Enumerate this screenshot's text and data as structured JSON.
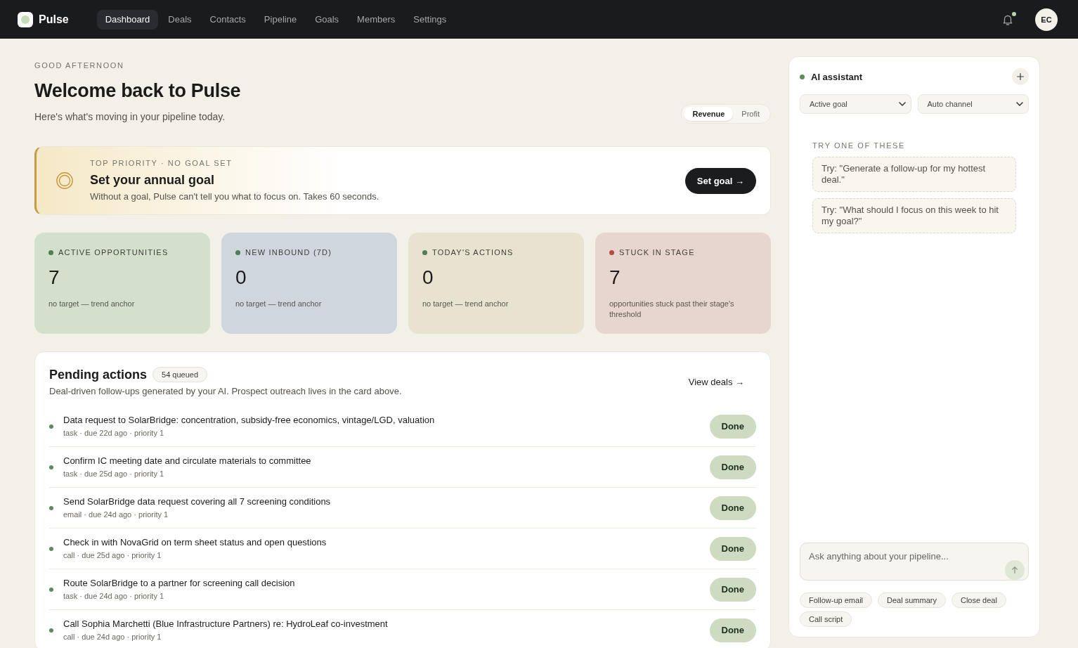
{
  "nav": {
    "logo": "Pulse",
    "links": [
      {
        "label": "Dashboard",
        "selected": true
      },
      {
        "label": "Deals",
        "selected": false
      },
      {
        "label": "Contacts",
        "selected": false
      },
      {
        "label": "Pipeline",
        "selected": false
      },
      {
        "label": "Goals",
        "selected": false
      },
      {
        "label": "Members",
        "selected": false
      },
      {
        "label": "Settings",
        "selected": false
      }
    ],
    "notifications": {
      "unread": true
    },
    "avatar": "EC"
  },
  "header": {
    "eyebrow": "GOOD AFTERNOON",
    "title": "Welcome back to Pulse",
    "subtitle": "Here's what's moving in your pipeline today.",
    "toggle": [
      {
        "label": "Revenue",
        "selected": true
      },
      {
        "label": "Profit",
        "selected": false
      }
    ]
  },
  "priority": {
    "eyebrow": "TOP PRIORITY · NO GOAL SET",
    "title": "Set your annual goal",
    "description": "Without a goal, Pulse can't tell you what to focus on. Takes 60 seconds.",
    "button": "Set goal →"
  },
  "stats": [
    {
      "kind": "opportunities",
      "label": "ACTIVE OPPORTUNITIES",
      "value": "7",
      "note": "no target — trend anchor",
      "color": "#4f7f55"
    },
    {
      "kind": "inbound",
      "label": "NEW INBOUND (7D)",
      "value": "0",
      "note": "no target — trend anchor",
      "color": "#4f7f55"
    },
    {
      "kind": "actions",
      "label": "TODAY'S ACTIONS",
      "value": "0",
      "note": "no target — trend anchor",
      "color": "#4f7f55"
    },
    {
      "kind": "stuck",
      "label": "STUCK IN STAGE",
      "value": "7",
      "note": "opportunities stuck past their stage's threshold",
      "color": "#b44b3d"
    }
  ],
  "pending": {
    "title": "Pending actions",
    "badge": "54 queued",
    "subtitle": "Deal-driven follow-ups generated by your AI. Prospect outreach lives in the card above.",
    "link": "View deals →",
    "items": [
      {
        "title": "Data request to SolarBridge: concentration, subsidy-free economics, vintage/LGD, valuation",
        "meta": "task · due 22d ago · priority 1",
        "button": "Done"
      },
      {
        "title": "Confirm IC meeting date and circulate materials to committee",
        "meta": "task · due 25d ago · priority 1",
        "button": "Done"
      },
      {
        "title": "Send SolarBridge data request covering all 7 screening conditions",
        "meta": "email · due 24d ago · priority 1",
        "button": "Done"
      },
      {
        "title": "Check in with NovaGrid on term sheet status and open questions",
        "meta": "call · due 25d ago · priority 1",
        "button": "Done"
      },
      {
        "title": "Route SolarBridge to a partner for screening call decision",
        "meta": "task · due 24d ago · priority 1",
        "button": "Done"
      },
      {
        "title": "Call Sophia Marchetti (Blue Infrastructure Partners) re: HydroLeaf co-investment",
        "meta": "call · due 24d ago · priority 1",
        "button": "Done"
      }
    ]
  },
  "assistant": {
    "title": "AI assistant",
    "selects": [
      {
        "value": "Active goal"
      },
      {
        "value": "Auto channel"
      }
    ],
    "suggestions_label": "TRY ONE OF THESE",
    "suggestions": [
      "Try: \"Generate a follow-up for my hottest deal.\"",
      "Try: \"What should I focus on this week to hit my goal?\""
    ],
    "input": {
      "placeholder": "Ask anything about your pipeline..."
    },
    "chips": [
      "Follow-up email",
      "Deal summary",
      "Close deal",
      "Call script"
    ]
  }
}
